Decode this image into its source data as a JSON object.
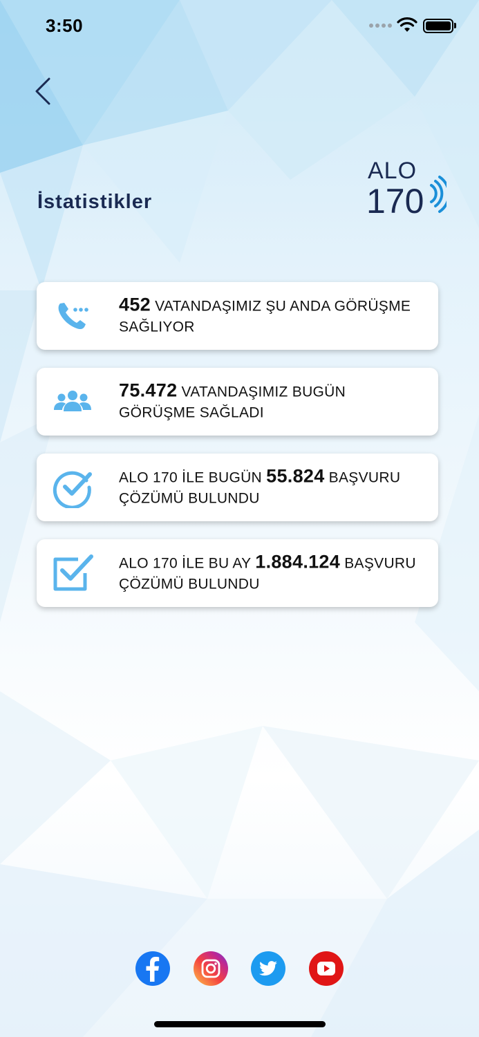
{
  "status_bar": {
    "time": "3:50"
  },
  "header": {
    "title": "İstatistikler"
  },
  "logo": {
    "line1": "ALO",
    "line2": "170"
  },
  "stats": [
    {
      "icon": "phone-call-icon",
      "number": "452",
      "before": "",
      "after": " VATANDAŞIMIZ ŞU ANDA GÖRÜŞME SAĞLIYOR"
    },
    {
      "icon": "users-group-icon",
      "number": "75.472",
      "before": "",
      "after": "  VATANDAŞIMIZ BUGÜN GÖRÜŞME SAĞLADI"
    },
    {
      "icon": "check-circle-icon",
      "number": "55.824",
      "before": "ALO 170 İLE BUGÜN ",
      "after": " BAŞVURU ÇÖZÜMÜ BULUNDU"
    },
    {
      "icon": "check-square-icon",
      "number": "1.884.124",
      "before": "ALO 170 İLE BU AY ",
      "after": " BAŞVURU ÇÖZÜMÜ BULUNDU"
    }
  ],
  "social": [
    "facebook-icon",
    "instagram-icon",
    "twitter-icon",
    "youtube-icon"
  ],
  "colors": {
    "accent": "#5ab4ec",
    "title": "#1a2a52",
    "logo": "#1a2a52"
  }
}
